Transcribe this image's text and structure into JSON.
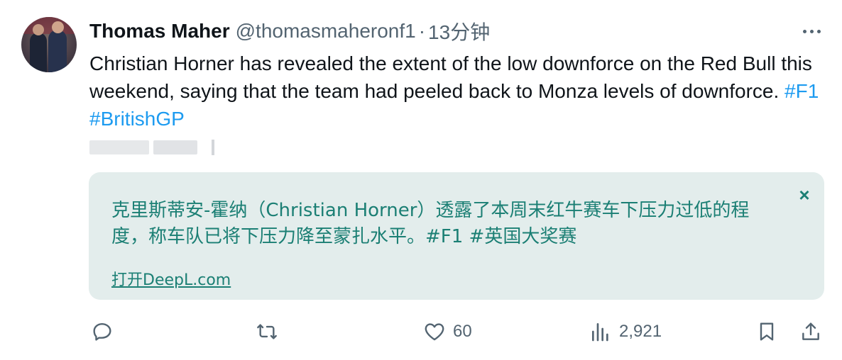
{
  "tweet": {
    "display_name": "Thomas Maher",
    "handle": "@thomasmaheronf1",
    "separator": "·",
    "time": "13分钟",
    "text_before": "Christian Horner has revealed the extent of the low downforce on the Red Bull this weekend, saying that the team had peeled back to Monza levels of downforce. ",
    "hashtag1": "#F1",
    "hashtag2": "#BritishGP"
  },
  "translation": {
    "text": "克里斯蒂安-霍纳（Christian Horner）透露了本周末红牛赛车下压力过低的程度，称车队已将下压力降至蒙扎水平。#F1 #英国大奖赛",
    "close_glyph": "×",
    "link_label": "打开DeepL.com"
  },
  "actions": {
    "reply_count": "",
    "retweet_count": "",
    "like_count": "60",
    "views_count": "2,921"
  },
  "icons": {
    "more": "more-horizontal-icon",
    "reply": "reply-icon",
    "retweet": "retweet-icon",
    "like": "heart-icon",
    "views": "views-chart-icon",
    "bookmark": "bookmark-icon",
    "share": "share-icon"
  },
  "colors": {
    "accent": "#1d9bf0",
    "translation_text": "#1b7f74",
    "translation_bg": "#e3edec",
    "secondary_text": "#536471"
  }
}
